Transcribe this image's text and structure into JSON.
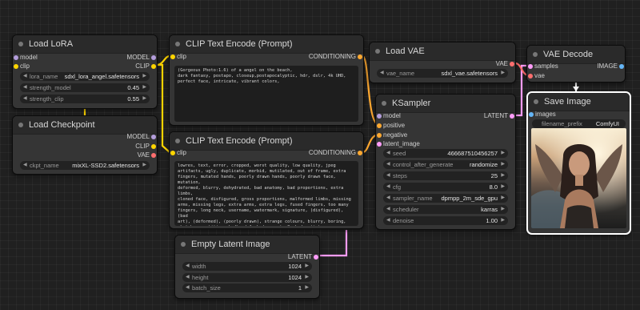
{
  "colors": {
    "model": "#b39ddb",
    "clip": "#ffd500",
    "vae": "#ff6e6e",
    "conditioning": "#ffa931",
    "latent": "#ff9cf9",
    "image": "#64b5f6",
    "background": "#202020",
    "node": "#353535"
  },
  "load_lora": {
    "title": "Load LoRA",
    "inputs": [
      "model",
      "clip"
    ],
    "outputs": [
      "MODEL",
      "CLIP"
    ],
    "widgets": [
      {
        "label": "lora_name",
        "value": "sdxl_lora_angel.safetensors"
      },
      {
        "label": "strength_model",
        "value": "0.45"
      },
      {
        "label": "strength_clip",
        "value": "0.55"
      }
    ]
  },
  "load_checkpoint": {
    "title": "Load Checkpoint",
    "outputs": [
      "MODEL",
      "CLIP",
      "VAE"
    ],
    "widgets": [
      {
        "label": "ckpt_name",
        "value": "mixXL-SSD2.safetensors"
      }
    ]
  },
  "clip_pos": {
    "title": "CLIP Text Encode (Prompt)",
    "input": "clip",
    "output": "CONDITIONING",
    "text": "(Gorgeous Photo:1.6) of a angel on the beach,\ndark fantasy, postapo, closeup,postapocalyptic, hdr, dslr, 4k UHD,\nperfect face, intricate, vibrant colors,"
  },
  "clip_neg": {
    "title": "CLIP Text Encode (Prompt)",
    "input": "clip",
    "output": "CONDITIONING",
    "text": "lowres, text, error, cropped, worst quality, low quality, jpeg\nartifacts, ugly, duplicate, morbid, mutilated, out of frame, extra\nfingers, mutated hands, poorly drawn hands, poorly drawn face, mutation,\ndeformed, blurry, dehydrated, bad anatomy, bad proportions, extra limbs,\ncloned face, disfigured, gross proportions, malformed limbs, missing\narms, missing legs, extra arms, extra legs, fused fingers, too many\nfingers, long neck, username, watermark, signature, (disfigured), (bad\nart), (deformed), (poorly drawn), strange colours, blurry, boring,\nsketch, repetitive, badhandv4, bad_prompt_v2, bad-artist, EasyNegative,\nDeepNegative"
  },
  "empty_latent": {
    "title": "Empty Latent Image",
    "output": "LATENT",
    "widgets": [
      {
        "label": "width",
        "value": "1024"
      },
      {
        "label": "height",
        "value": "1024"
      },
      {
        "label": "batch_size",
        "value": "1"
      }
    ]
  },
  "load_vae": {
    "title": "Load VAE",
    "output": "VAE",
    "widgets": [
      {
        "label": "vae_name",
        "value": "sdxl_vae.safetensors"
      }
    ]
  },
  "ksampler": {
    "title": "KSampler",
    "inputs": [
      "model",
      "positive",
      "negative",
      "latent_image"
    ],
    "output": "LATENT",
    "widgets": [
      {
        "label": "seed",
        "value": "466687510456257"
      },
      {
        "label": "control_after_generate",
        "value": "randomize"
      },
      {
        "label": "steps",
        "value": "25"
      },
      {
        "label": "cfg",
        "value": "8.0"
      },
      {
        "label": "sampler_name",
        "value": "dpmpp_2m_sde_gpu"
      },
      {
        "label": "scheduler",
        "value": "karras"
      },
      {
        "label": "denoise",
        "value": "1.00"
      }
    ]
  },
  "vae_decode": {
    "title": "VAE Decode",
    "inputs": [
      "samples",
      "vae"
    ],
    "output": "IMAGE"
  },
  "save_image": {
    "title": "Save Image",
    "input": "images",
    "widgets": [
      {
        "label": "filename_prefix",
        "value": "ComfyUI"
      }
    ],
    "image_icon": "generated-angel-portrait"
  }
}
